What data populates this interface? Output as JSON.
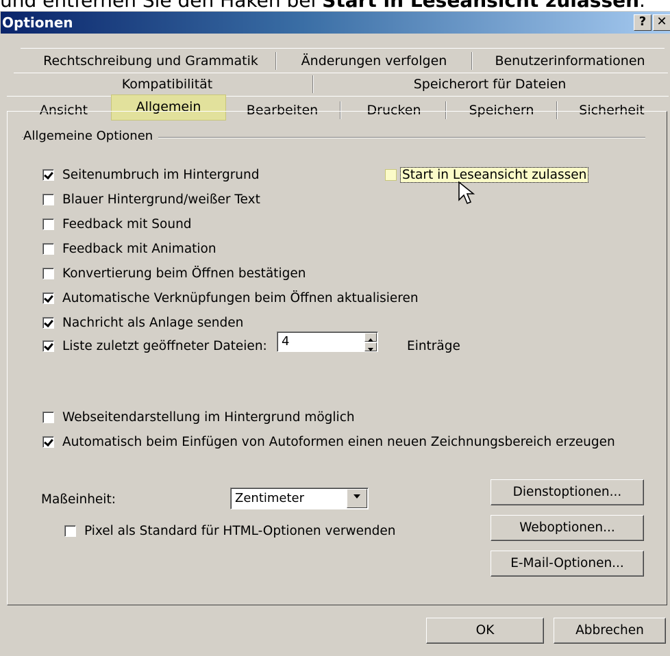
{
  "caption": {
    "prefix": "und entfernen Sie den Haken bei ",
    "bold": "Start in Leseansicht zulassen",
    "suffix": "."
  },
  "window": {
    "title": "Optionen",
    "help_button": "?",
    "close_button": "✕"
  },
  "tabs": {
    "row1": [
      "Rechtschreibung und Grammatik",
      "Änderungen verfolgen",
      "Benutzerinformationen"
    ],
    "row2": [
      "Kompatibilität",
      "Speicherort für Dateien"
    ],
    "row3": [
      "Ansicht",
      "Allgemein",
      "Bearbeiten",
      "Drucken",
      "Speichern",
      "Sicherheit"
    ],
    "active": "Allgemein"
  },
  "group": {
    "label": "Allgemeine Optionen"
  },
  "options": [
    {
      "label": "Seitenumbruch im Hintergrund",
      "checked": true
    },
    {
      "label": "Blauer Hintergrund/weißer Text",
      "checked": false
    },
    {
      "label": "Feedback mit Sound",
      "checked": false
    },
    {
      "label": "Feedback mit Animation",
      "checked": false
    },
    {
      "label": "Konvertierung beim Öffnen bestätigen",
      "checked": false
    },
    {
      "label": "Automatische Verknüpfungen beim Öffnen aktualisieren",
      "checked": true
    },
    {
      "label": "Nachricht als Anlage senden",
      "checked": true
    },
    {
      "label": "Liste zuletzt geöffneter Dateien:",
      "checked": true
    },
    {
      "label": "Start in Leseansicht zulassen",
      "checked": false
    },
    {
      "label": "Webseitendarstellung im Hintergrund möglich",
      "checked": false
    },
    {
      "label": "Automatisch beim Einfügen von Autoformen einen neuen Zeichnungsbereich erzeugen",
      "checked": true
    },
    {
      "label": "Pixel als Standard für HTML-Optionen verwenden",
      "checked": false
    }
  ],
  "recent_files": {
    "value": "4",
    "suffix": "Einträge"
  },
  "units": {
    "label": "Maßeinheit:",
    "selected": "Zentimeter"
  },
  "buttons": {
    "service": "Dienstoptionen...",
    "web": "Weboptionen...",
    "email": "E-Mail-Optionen...",
    "ok": "OK",
    "cancel": "Abbrechen"
  },
  "colors": {
    "face": "#d4d0c8",
    "highlight": "#e2e19c",
    "title_start": "#0a246a",
    "title_end": "#a6caf0"
  }
}
